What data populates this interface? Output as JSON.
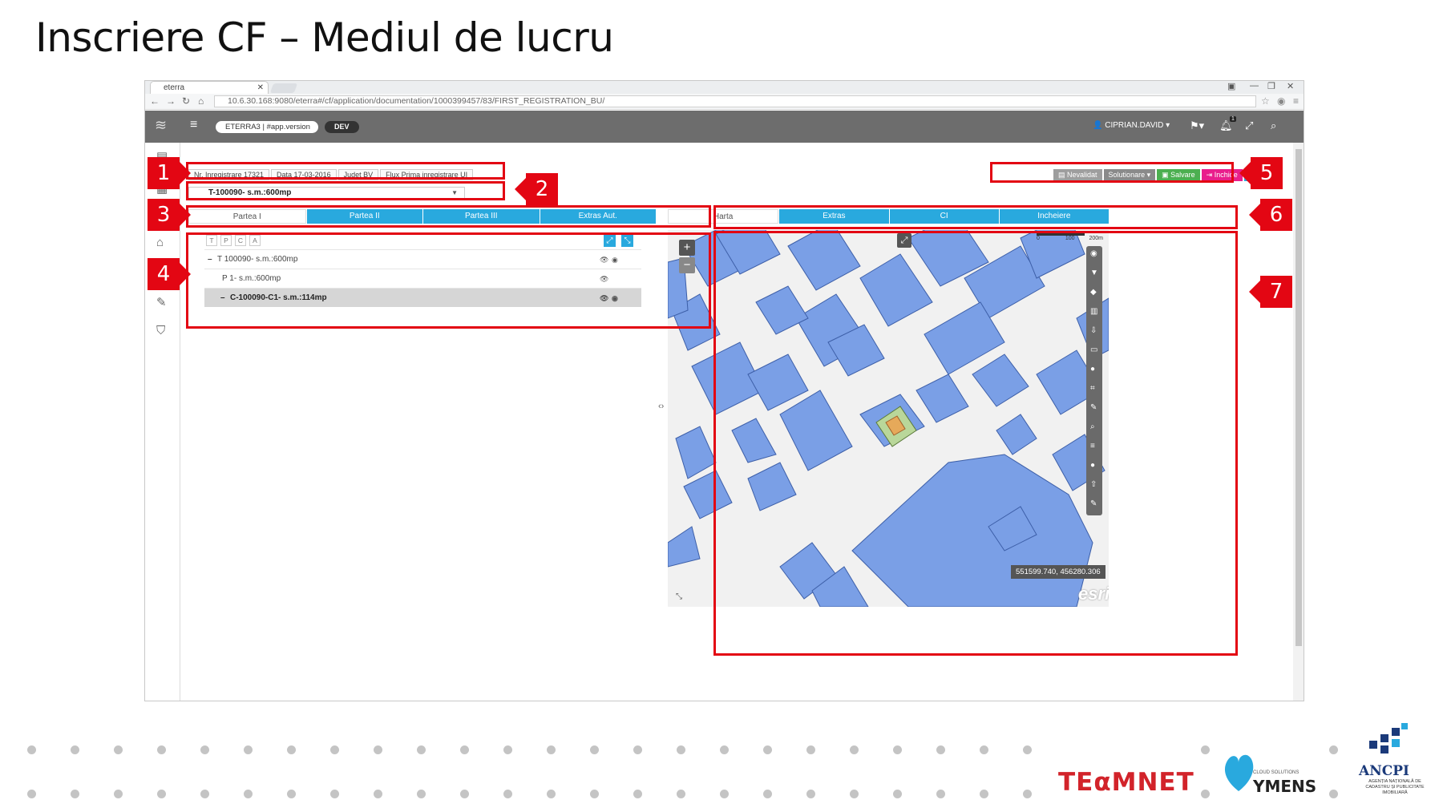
{
  "slide": {
    "title": "Inscriere CF – Mediul de lucru"
  },
  "browser": {
    "tab_title": "eterra",
    "url": "10.6.30.168:9080/eterra#/cf/application/documentation/1000399457/83/FIRST_REGISTRATION_BU/"
  },
  "appbar": {
    "app_pill": "ETERRA3 | #app.version",
    "env_badge": "DEV",
    "user": "CIPRIAN.DAVID",
    "notif_count": "1"
  },
  "info": {
    "nr_inregistrare": "Nr. Inregistrare 17321",
    "data": "Data 17-03-2016",
    "judet": "Judet BV",
    "flux": "Flux Prima inregistrare UI",
    "selected_unit": "T-100090- s.m.:600mp"
  },
  "actions": [
    {
      "label": "Nevalidat",
      "color": "#9e9e9e"
    },
    {
      "label": "Solutionare",
      "color": "#8a8a8a"
    },
    {
      "label": "Salvare",
      "color": "#4caf50"
    },
    {
      "label": "Inchide",
      "color": "#e91e8c"
    }
  ],
  "left_tabs": [
    "Partea I",
    "Partea II",
    "Partea III",
    "Extras Aut."
  ],
  "right_tabs": [
    "Harta",
    "Extras",
    "CI",
    "Incheiere"
  ],
  "tree": {
    "chips": [
      "T",
      "P",
      "C",
      "A"
    ],
    "rows": [
      {
        "label": "T 100090- s.m.:600mp",
        "expanded": true
      },
      {
        "label": "P 1- s.m.:600mp",
        "expanded": false
      },
      {
        "label": "C-100090-C1- s.m.:114mp",
        "expanded": true,
        "selected": true
      }
    ]
  },
  "map": {
    "coords": "551599.740, 456280.306",
    "esri": "esri",
    "scale_left": "0",
    "scale_mid": "100",
    "scale_right": "200m",
    "parcel_color": "#7a9fe6",
    "selected_parcel_color": "#e6a95a"
  },
  "annotations": [
    "1",
    "2",
    "3",
    "4",
    "5",
    "6",
    "7"
  ],
  "footer": {
    "teamnet": "TEαMNET",
    "ymens": "YMENS",
    "ymens_sub": "CLOUD SOLUTIONS",
    "ancpi": "ANCPI",
    "ancpi_sub": "AGENȚIA NAȚIONALĂ DE CADASTRU ȘI PUBLICITATE IMOBILIARĂ"
  }
}
